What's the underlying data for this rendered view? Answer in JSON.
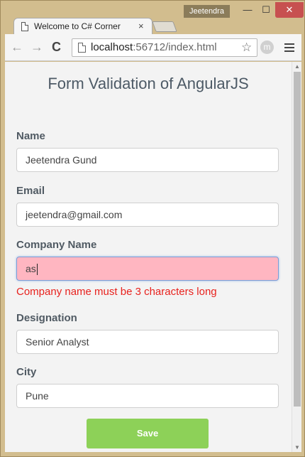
{
  "window": {
    "user": "Jeetendra",
    "minimize": "—",
    "maximize": "☐",
    "close": "✕"
  },
  "tab": {
    "title": "Welcome to C# Corner",
    "close": "×"
  },
  "toolbar": {
    "back": "←",
    "forward": "→",
    "reload": "C",
    "url_host": "localhost",
    "url_rest": ":56712/index.html",
    "star": "☆",
    "extension": "m"
  },
  "page": {
    "title": "Form Validation of AngularJS",
    "fields": [
      {
        "label": "Name",
        "value": "Jeetendra Gund"
      },
      {
        "label": "Email",
        "value": "jeetendra@gmail.com"
      },
      {
        "label": "Company Name",
        "value": "as"
      },
      {
        "label": "Designation",
        "value": "Senior Analyst"
      },
      {
        "label": "City",
        "value": "Pune"
      }
    ],
    "error": "Company name must be 3 characters long",
    "save_label": "Save"
  },
  "colors": {
    "invalid_bg": "#ffb6c1",
    "error_text": "#e8221e",
    "save_button": "#8dd158"
  }
}
